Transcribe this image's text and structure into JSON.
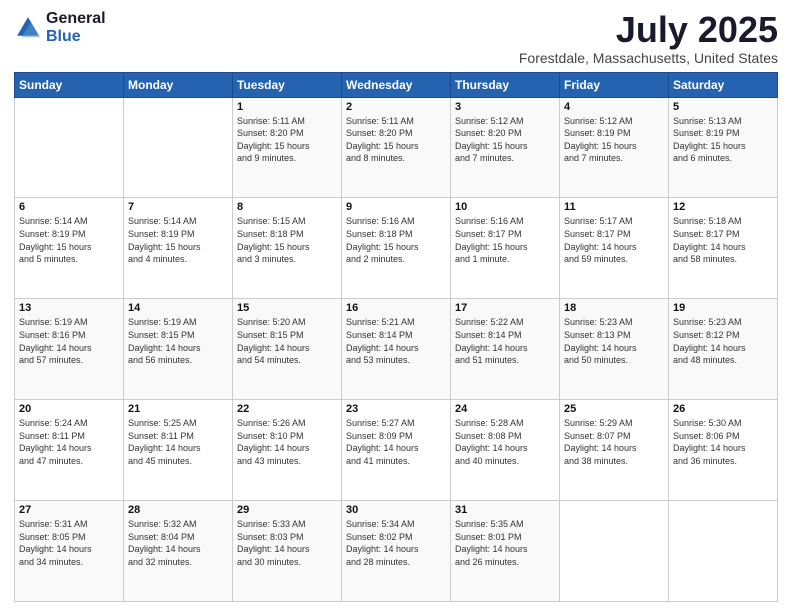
{
  "logo": {
    "general": "General",
    "blue": "Blue"
  },
  "title": {
    "month": "July 2025",
    "location": "Forestdale, Massachusetts, United States"
  },
  "weekdays": [
    "Sunday",
    "Monday",
    "Tuesday",
    "Wednesday",
    "Thursday",
    "Friday",
    "Saturday"
  ],
  "weeks": [
    [
      {
        "day": "",
        "info": ""
      },
      {
        "day": "",
        "info": ""
      },
      {
        "day": "1",
        "info": "Sunrise: 5:11 AM\nSunset: 8:20 PM\nDaylight: 15 hours\nand 9 minutes."
      },
      {
        "day": "2",
        "info": "Sunrise: 5:11 AM\nSunset: 8:20 PM\nDaylight: 15 hours\nand 8 minutes."
      },
      {
        "day": "3",
        "info": "Sunrise: 5:12 AM\nSunset: 8:20 PM\nDaylight: 15 hours\nand 7 minutes."
      },
      {
        "day": "4",
        "info": "Sunrise: 5:12 AM\nSunset: 8:19 PM\nDaylight: 15 hours\nand 7 minutes."
      },
      {
        "day": "5",
        "info": "Sunrise: 5:13 AM\nSunset: 8:19 PM\nDaylight: 15 hours\nand 6 minutes."
      }
    ],
    [
      {
        "day": "6",
        "info": "Sunrise: 5:14 AM\nSunset: 8:19 PM\nDaylight: 15 hours\nand 5 minutes."
      },
      {
        "day": "7",
        "info": "Sunrise: 5:14 AM\nSunset: 8:19 PM\nDaylight: 15 hours\nand 4 minutes."
      },
      {
        "day": "8",
        "info": "Sunrise: 5:15 AM\nSunset: 8:18 PM\nDaylight: 15 hours\nand 3 minutes."
      },
      {
        "day": "9",
        "info": "Sunrise: 5:16 AM\nSunset: 8:18 PM\nDaylight: 15 hours\nand 2 minutes."
      },
      {
        "day": "10",
        "info": "Sunrise: 5:16 AM\nSunset: 8:17 PM\nDaylight: 15 hours\nand 1 minute."
      },
      {
        "day": "11",
        "info": "Sunrise: 5:17 AM\nSunset: 8:17 PM\nDaylight: 14 hours\nand 59 minutes."
      },
      {
        "day": "12",
        "info": "Sunrise: 5:18 AM\nSunset: 8:17 PM\nDaylight: 14 hours\nand 58 minutes."
      }
    ],
    [
      {
        "day": "13",
        "info": "Sunrise: 5:19 AM\nSunset: 8:16 PM\nDaylight: 14 hours\nand 57 minutes."
      },
      {
        "day": "14",
        "info": "Sunrise: 5:19 AM\nSunset: 8:15 PM\nDaylight: 14 hours\nand 56 minutes."
      },
      {
        "day": "15",
        "info": "Sunrise: 5:20 AM\nSunset: 8:15 PM\nDaylight: 14 hours\nand 54 minutes."
      },
      {
        "day": "16",
        "info": "Sunrise: 5:21 AM\nSunset: 8:14 PM\nDaylight: 14 hours\nand 53 minutes."
      },
      {
        "day": "17",
        "info": "Sunrise: 5:22 AM\nSunset: 8:14 PM\nDaylight: 14 hours\nand 51 minutes."
      },
      {
        "day": "18",
        "info": "Sunrise: 5:23 AM\nSunset: 8:13 PM\nDaylight: 14 hours\nand 50 minutes."
      },
      {
        "day": "19",
        "info": "Sunrise: 5:23 AM\nSunset: 8:12 PM\nDaylight: 14 hours\nand 48 minutes."
      }
    ],
    [
      {
        "day": "20",
        "info": "Sunrise: 5:24 AM\nSunset: 8:11 PM\nDaylight: 14 hours\nand 47 minutes."
      },
      {
        "day": "21",
        "info": "Sunrise: 5:25 AM\nSunset: 8:11 PM\nDaylight: 14 hours\nand 45 minutes."
      },
      {
        "day": "22",
        "info": "Sunrise: 5:26 AM\nSunset: 8:10 PM\nDaylight: 14 hours\nand 43 minutes."
      },
      {
        "day": "23",
        "info": "Sunrise: 5:27 AM\nSunset: 8:09 PM\nDaylight: 14 hours\nand 41 minutes."
      },
      {
        "day": "24",
        "info": "Sunrise: 5:28 AM\nSunset: 8:08 PM\nDaylight: 14 hours\nand 40 minutes."
      },
      {
        "day": "25",
        "info": "Sunrise: 5:29 AM\nSunset: 8:07 PM\nDaylight: 14 hours\nand 38 minutes."
      },
      {
        "day": "26",
        "info": "Sunrise: 5:30 AM\nSunset: 8:06 PM\nDaylight: 14 hours\nand 36 minutes."
      }
    ],
    [
      {
        "day": "27",
        "info": "Sunrise: 5:31 AM\nSunset: 8:05 PM\nDaylight: 14 hours\nand 34 minutes."
      },
      {
        "day": "28",
        "info": "Sunrise: 5:32 AM\nSunset: 8:04 PM\nDaylight: 14 hours\nand 32 minutes."
      },
      {
        "day": "29",
        "info": "Sunrise: 5:33 AM\nSunset: 8:03 PM\nDaylight: 14 hours\nand 30 minutes."
      },
      {
        "day": "30",
        "info": "Sunrise: 5:34 AM\nSunset: 8:02 PM\nDaylight: 14 hours\nand 28 minutes."
      },
      {
        "day": "31",
        "info": "Sunrise: 5:35 AM\nSunset: 8:01 PM\nDaylight: 14 hours\nand 26 minutes."
      },
      {
        "day": "",
        "info": ""
      },
      {
        "day": "",
        "info": ""
      }
    ]
  ]
}
